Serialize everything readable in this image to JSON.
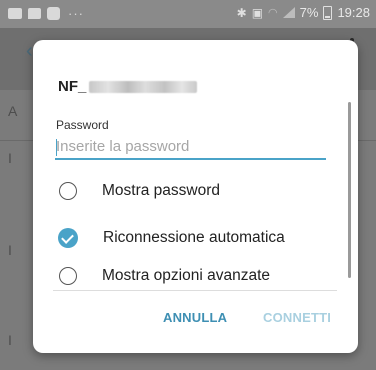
{
  "status_bar": {
    "battery": "7%",
    "time": "19:28",
    "overflow": "···",
    "left_icons": [
      "image-icon",
      "chat-icon",
      "b-app-icon"
    ],
    "right_icons": [
      "bluetooth-icon",
      "vibrate-icon",
      "wifi-icon",
      "signal-icon",
      "battery-icon"
    ]
  },
  "background": {
    "row_letters": [
      "A",
      "I",
      "I",
      "I"
    ]
  },
  "dialog": {
    "title": "NF_",
    "password_label": "Password",
    "password_placeholder": "Inserite la password",
    "password_value": "",
    "options": [
      {
        "label": "Mostra password",
        "checked": false
      },
      {
        "label": "Riconnessione automatica",
        "checked": true
      },
      {
        "label": "Mostra opzioni avanzate",
        "checked": false
      }
    ],
    "cancel_label": "ANNULLA",
    "connect_label": "CONNETTI"
  },
  "colors": {
    "accent": "#4aa3c8",
    "accent_disabled": "#a9d0e0",
    "scrim": "#7b7b7b"
  }
}
